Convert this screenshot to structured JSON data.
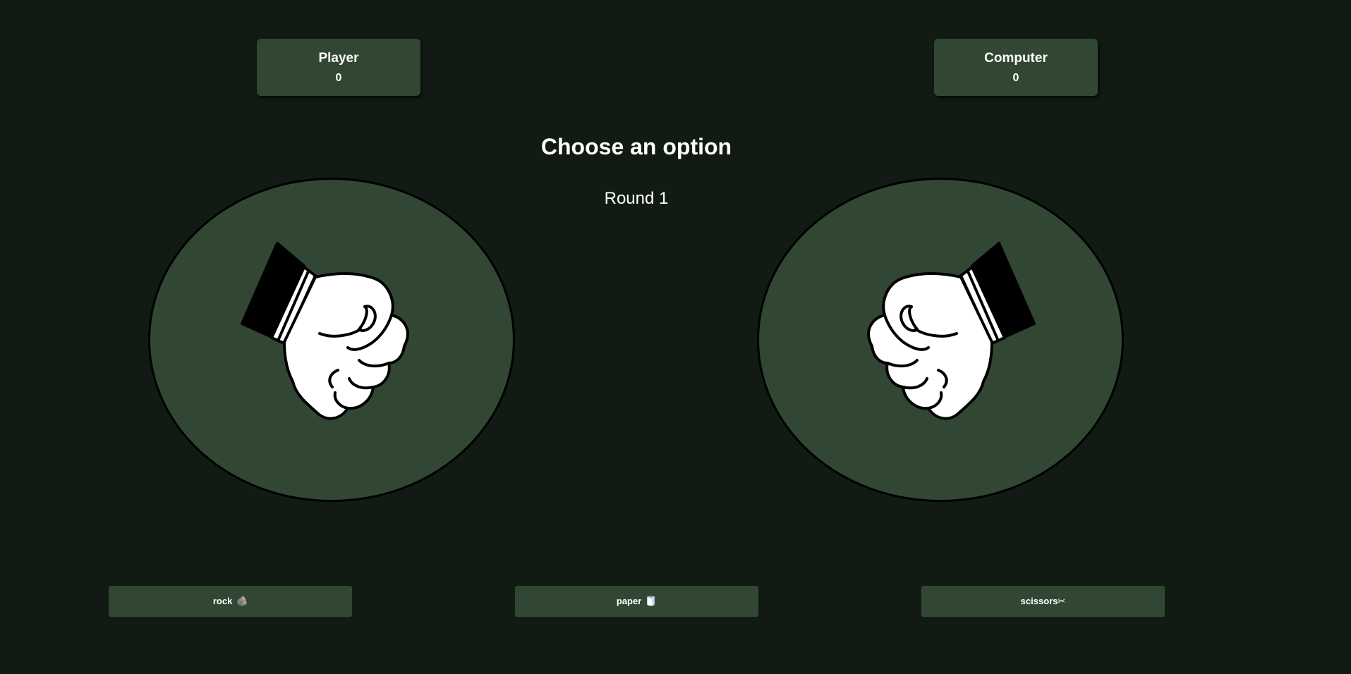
{
  "scoreboard": {
    "player": {
      "name": "Player",
      "score": "0"
    },
    "computer": {
      "name": "Computer",
      "score": "0"
    }
  },
  "game": {
    "heading": "Choose an option",
    "round": "Round 1",
    "player_hand": "fist-icon",
    "computer_hand": "fist-icon"
  },
  "choices": [
    {
      "label": "rock",
      "icon": "🪨"
    },
    {
      "label": "paper",
      "icon": "🧻"
    },
    {
      "label": "scissors",
      "icon": "✂"
    }
  ],
  "colors": {
    "background": "#111b14",
    "panel": "#314733",
    "text": "#ffffff"
  }
}
